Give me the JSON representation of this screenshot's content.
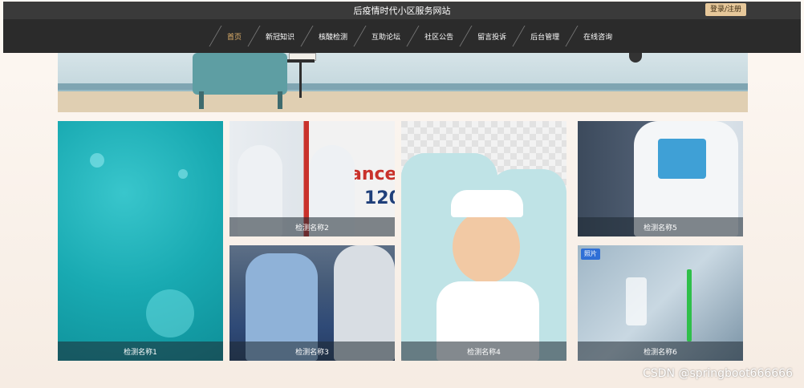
{
  "header": {
    "site_title": "后疫情时代小区服务网站",
    "login_label": "登录/注册"
  },
  "nav": {
    "items": [
      {
        "label": "首页",
        "active": true
      },
      {
        "label": "新冠知识",
        "active": false
      },
      {
        "label": "核酸检测",
        "active": false
      },
      {
        "label": "互助论坛",
        "active": false
      },
      {
        "label": "社区公告",
        "active": false
      },
      {
        "label": "留言投诉",
        "active": false
      },
      {
        "label": "后台管理",
        "active": false
      },
      {
        "label": "在线咨询",
        "active": false
      }
    ]
  },
  "tiles": [
    {
      "caption": "检测名称1"
    },
    {
      "caption": "检测名称2",
      "sign_text": "ance",
      "sign_number": "120"
    },
    {
      "caption": "检测名称3"
    },
    {
      "caption": "检测名称4"
    },
    {
      "caption": "检测名称5"
    },
    {
      "caption": "检测名称6",
      "badge": "照片"
    }
  ],
  "watermark": "CSDN @springboot666666",
  "colors": {
    "topbar": "#3a3a3a",
    "navbar": "#2b2b2b",
    "nav_active": "#e4b46c",
    "login_button": "#e7c89a",
    "teal_tile": "#19aab2",
    "photo_badge": "#2f6fd6"
  }
}
